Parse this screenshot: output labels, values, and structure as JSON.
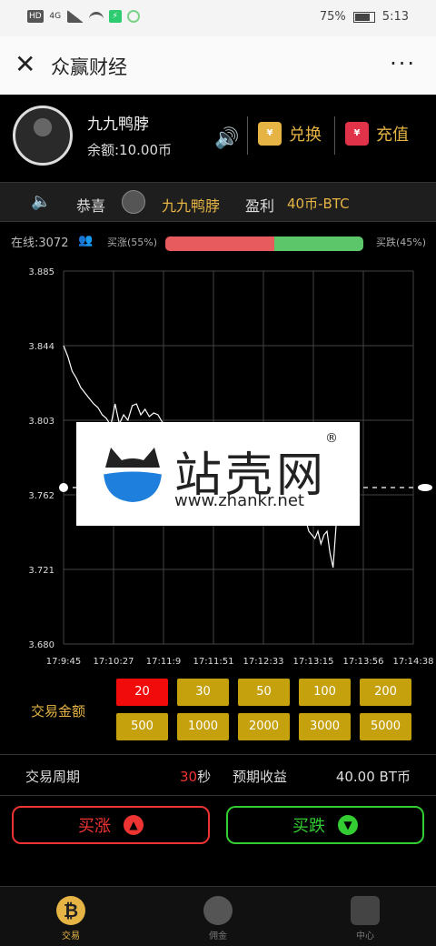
{
  "status_bar": {
    "network": "HD",
    "signal": "4G",
    "battery": "75%",
    "time": "5:13"
  },
  "navbar": {
    "close_icon": "close-icon",
    "title": "众赢财经",
    "more": "···"
  },
  "user": {
    "name": "九九鸭脖",
    "balance": "余额:10.00币",
    "exchange_label": "兑换",
    "recharge_label": "充值",
    "exchange_icon_text": "¥",
    "recharge_icon_text": "¥"
  },
  "notice": {
    "congrats": "恭喜",
    "name": "九九鸭脖",
    "profit_label": "盈利",
    "amount": "40币-BTC"
  },
  "sentiment": {
    "online": "在线:3072",
    "rise_label": "买涨(55%)",
    "fall_label": "买跌(45%)",
    "rise_pct": 55,
    "fall_pct": 45,
    "rise_color": "#e75a5e",
    "fall_color": "#5cc76a"
  },
  "chart_data": {
    "type": "line",
    "y_ticks": [
      "3.885",
      "3.844",
      "3.803",
      "3.762",
      "3.721",
      "3.680"
    ],
    "x_ticks": [
      "17:9:45",
      "17:10:27",
      "17:11:9",
      "17:11:51",
      "17:12:33",
      "17:13:15",
      "17:13:56",
      "17:14:38"
    ],
    "ylim": [
      3.68,
      3.885
    ],
    "grid": true,
    "line_color": "#ffffff",
    "series": [
      {
        "values": [
          3.844,
          3.838,
          3.83,
          3.826,
          3.821,
          3.818,
          3.815,
          3.812,
          3.81,
          3.806,
          3.804,
          3.8,
          3.812,
          3.801,
          3.806,
          3.803,
          3.811,
          3.812,
          3.806,
          3.809,
          3.805,
          3.807,
          3.806,
          3.802,
          3.8,
          3.796,
          3.79,
          3.785,
          3.78,
          3.778,
          3.775,
          3.772,
          3.77,
          3.768,
          3.766,
          3.764,
          3.762
        ]
      },
      {
        "values": [
          3.762,
          3.755,
          3.748,
          3.742,
          3.74,
          3.738,
          3.742,
          3.735,
          3.74,
          3.742,
          3.73,
          3.722,
          3.745,
          3.75,
          3.755,
          3.758
        ]
      }
    ],
    "current_value": 3.766
  },
  "trade": {
    "amount_label": "交易金额",
    "amounts": [
      "20",
      "30",
      "50",
      "100",
      "200",
      "500",
      "1000",
      "2000",
      "3000",
      "5000"
    ],
    "selected_amount": "20",
    "period_label": "交易周期",
    "period_value": "30",
    "period_unit": "秒",
    "income_label": "预期收益",
    "income_value": "40.00 BT币",
    "buy_up": "买涨",
    "buy_down": "买跌"
  },
  "tabs": {
    "trade": "交易",
    "commission": "佣金",
    "center": "中心",
    "trade_icon_text": "₿"
  },
  "watermark": {
    "name": "站壳网",
    "url": "www.zhankr.net",
    "registered": "®"
  }
}
